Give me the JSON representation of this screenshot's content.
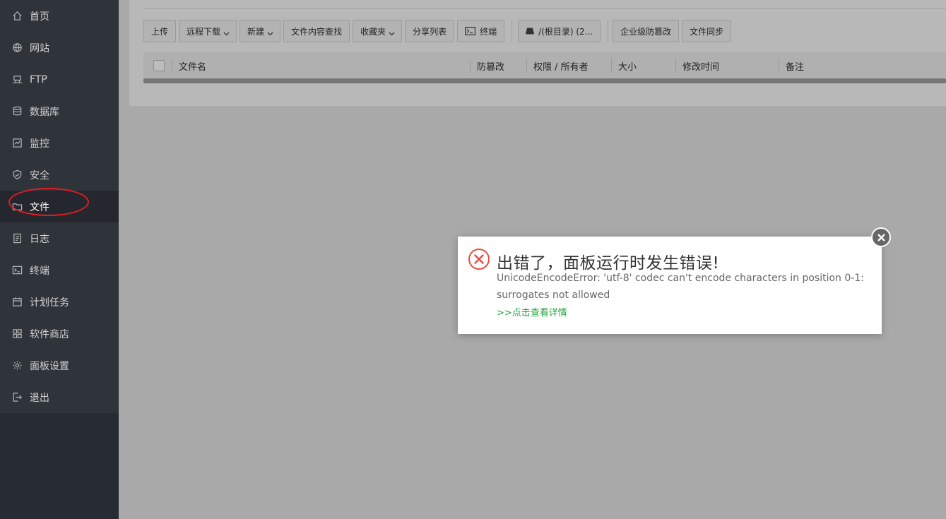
{
  "sidebar": {
    "items": [
      {
        "label": "首页",
        "icon": "home-icon"
      },
      {
        "label": "网站",
        "icon": "globe-icon"
      },
      {
        "label": "FTP",
        "icon": "ftp-icon"
      },
      {
        "label": "数据库",
        "icon": "database-icon"
      },
      {
        "label": "监控",
        "icon": "monitor-icon"
      },
      {
        "label": "安全",
        "icon": "shield-icon"
      },
      {
        "label": "文件",
        "icon": "folder-icon"
      },
      {
        "label": "日志",
        "icon": "log-icon"
      },
      {
        "label": "终端",
        "icon": "terminal-icon"
      },
      {
        "label": "计划任务",
        "icon": "calendar-icon"
      },
      {
        "label": "软件商店",
        "icon": "grid-icon"
      },
      {
        "label": "面板设置",
        "icon": "gear-icon"
      },
      {
        "label": "退出",
        "icon": "logout-icon"
      }
    ],
    "active": "文件"
  },
  "toolbar": {
    "upload": "上传",
    "remote_download": "远程下载",
    "new": "新建",
    "search_content": "文件内容查找",
    "favorites": "收藏夹",
    "share_list": "分享列表",
    "terminal": "终端",
    "path": "/(根目录) (2...",
    "tamper_protect": "企业级防篡改",
    "file_sync": "文件同步"
  },
  "table": {
    "columns": [
      "文件名",
      "防篡改",
      "权限 / 所有者",
      "大小",
      "修改时间",
      "备注"
    ]
  },
  "dialog": {
    "title": "出错了，面板运行时发生错误!",
    "message": "UnicodeEncodeError: 'utf-8' codec can't encode characters in position 0-1: surrogates not allowed",
    "details_link": ">>点击查看详情"
  },
  "colors": {
    "sidebar_bg": "#2f343a",
    "annotation_red": "#e51c23",
    "error_red": "#e94b3c",
    "link_green": "#20a53a"
  }
}
